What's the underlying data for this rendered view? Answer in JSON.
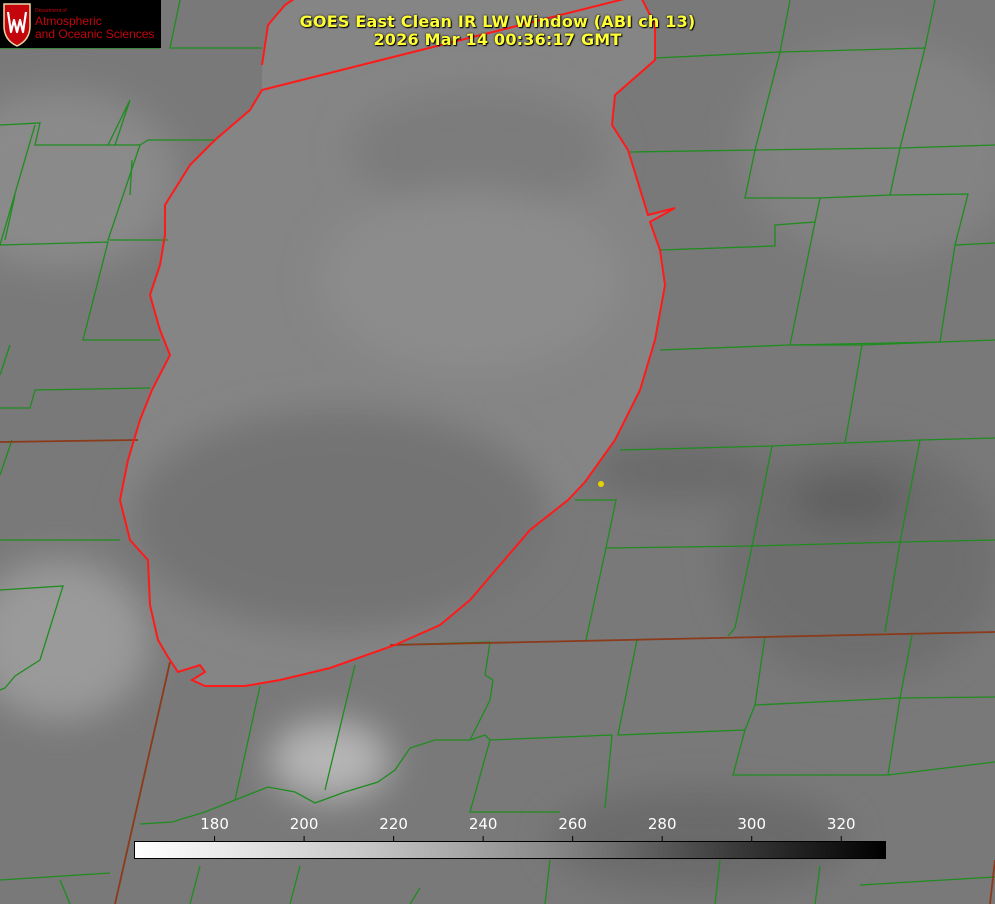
{
  "title": {
    "line1": "GOES East Clean IR LW Window (ABI ch 13)",
    "line2": "2026 Mar 14 00:36:17 GMT"
  },
  "logo": {
    "department": "Department of",
    "line1": "Atmospheric",
    "line2": "and Oceanic Sciences",
    "color": "#c5050c"
  },
  "colorbar": {
    "ticks": [
      "180",
      "200",
      "220",
      "240",
      "260",
      "280",
      "300",
      "320"
    ],
    "min": 162,
    "max": 330
  },
  "colors": {
    "county_lines": "#1e8c1e",
    "state_lines": "#8b3a1a",
    "lake_shore": "#ff1a1a",
    "station_marker": "#e6d200",
    "title_text": "#ffff33"
  }
}
